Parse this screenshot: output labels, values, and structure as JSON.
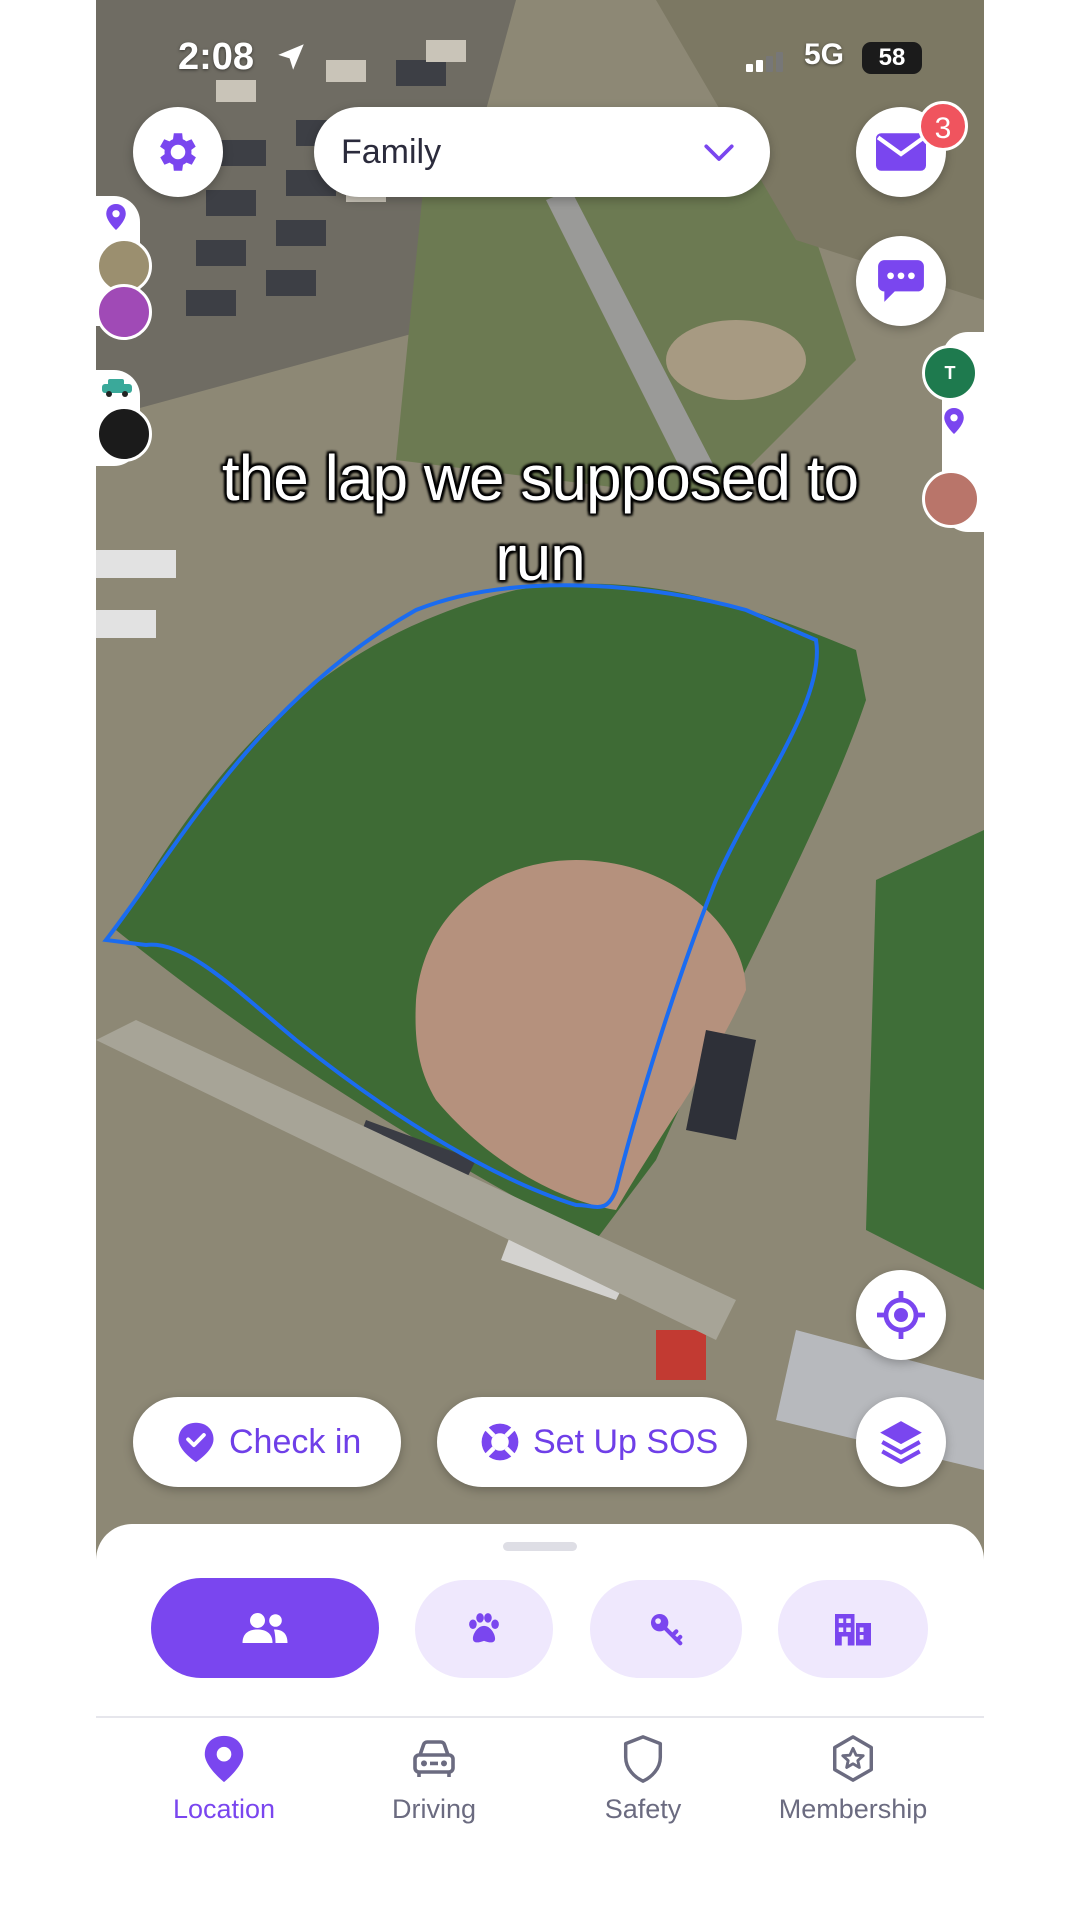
{
  "status_bar": {
    "time": "2:08",
    "network": "5G",
    "battery": "58"
  },
  "circle_selector": {
    "label": "Family"
  },
  "notifications": {
    "mail_badge": "3"
  },
  "caption": {
    "line1": "the lap we supposed to",
    "line2": "run"
  },
  "map_avatars": {
    "right_initial": "T"
  },
  "actions": {
    "checkin_label": "Check in",
    "sos_label": "Set Up SOS"
  },
  "segments": [
    "people-icon",
    "paw-icon",
    "keys-icon",
    "building-icon"
  ],
  "tabs": [
    {
      "label": "Location",
      "icon": "location-pin-icon",
      "active": true
    },
    {
      "label": "Driving",
      "icon": "car-icon",
      "active": false
    },
    {
      "label": "Safety",
      "icon": "shield-icon",
      "active": false
    },
    {
      "label": "Membership",
      "icon": "badge-star-icon",
      "active": false
    }
  ],
  "colors": {
    "accent": "#7a46ef",
    "accent_light": "#efe8fd",
    "route": "#1b6cf0",
    "badge": "#f0545e"
  }
}
